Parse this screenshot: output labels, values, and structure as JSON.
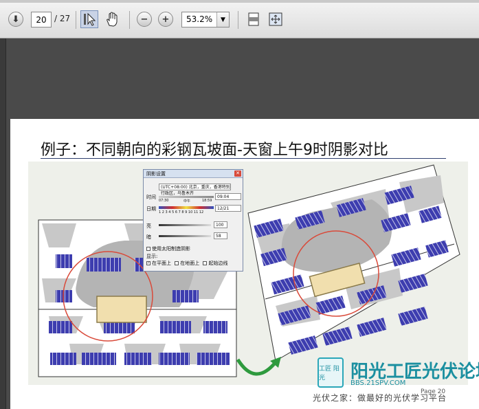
{
  "toolbar": {
    "page_current": "20",
    "page_total": "/ 27",
    "zoom": "53.2%"
  },
  "slide": {
    "title": "例子：不同朝向的彩钢瓦坡面-天窗上午9时阴影对比",
    "page_label": "Page 20"
  },
  "dialog": {
    "title": "阴影设置",
    "timezone": "(UTC+08:00) 北京，重庆，香港特别行政区，乌鲁木齐",
    "time_label": "时间",
    "time_start": "07:30",
    "time_mid": "中午",
    "time_end": "18:59",
    "time_value": "09:04",
    "date_label": "日期",
    "months": "1 2 3 4 5 6 7 8 9 10 11 12",
    "date_value": "12/21",
    "light_label": "亮",
    "light_value": "100",
    "dark_label": "暗",
    "dark_value": "58",
    "option_sun": "使用太阳制造阴影",
    "display_label": "显示:",
    "opt_faces": "在平面上",
    "opt_ground": "在地面上",
    "opt_edges": "起始边线"
  },
  "watermark": {
    "logo_chars": "工匠 阳光",
    "brand": "阳光工匠光伏论坛",
    "url": "BBS.21SPV.COM",
    "footer": "光伏之家：做最好的光伏学习平台"
  },
  "colors": {
    "panel_blue": "#3a3aa8",
    "highlight_red": "#d94a3a",
    "arrow_green": "#2e9a3e",
    "skylight_fill": "#f1dfae"
  }
}
